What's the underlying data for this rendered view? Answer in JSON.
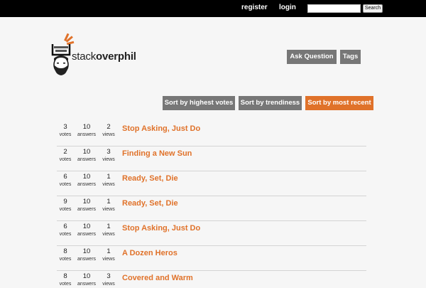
{
  "topbar": {
    "register": "register",
    "login": "login",
    "search_value": "",
    "search_button": "Search"
  },
  "logo": {
    "text_light": "stack",
    "text_bold": "overphil"
  },
  "header_buttons": {
    "ask": "Ask Question",
    "tags": "Tags"
  },
  "sort": {
    "highest_votes": "Sort by highest votes",
    "trendiness": "Sort by trendiness",
    "most_recent": "Sort by most recent",
    "active": "most_recent"
  },
  "colors": {
    "accent": "#e0722a",
    "button_gray": "#777777",
    "topbar": "#000000"
  },
  "questions": [
    {
      "votes": "3",
      "votes_label": "votes",
      "answers": "10",
      "answers_label": "answers",
      "views": "2",
      "views_label": "views",
      "title": "Stop Asking, Just Do"
    },
    {
      "votes": "2",
      "votes_label": "votes",
      "answers": "10",
      "answers_label": "answers",
      "views": "3",
      "views_label": "views",
      "title": "Finding a New Sun"
    },
    {
      "votes": "6",
      "votes_label": "votes",
      "answers": "10",
      "answers_label": "answers",
      "views": "1",
      "views_label": "views",
      "title": "Ready, Set, Die"
    },
    {
      "votes": "9",
      "votes_label": "votes",
      "answers": "10",
      "answers_label": "answers",
      "views": "1",
      "views_label": "views",
      "title": "Ready, Set, Die"
    },
    {
      "votes": "6",
      "votes_label": "votes",
      "answers": "10",
      "answers_label": "answers",
      "views": "1",
      "views_label": "views",
      "title": "Stop Asking, Just Do"
    },
    {
      "votes": "8",
      "votes_label": "votes",
      "answers": "10",
      "answers_label": "answers",
      "views": "1",
      "views_label": "views",
      "title": "A Dozen Heros"
    },
    {
      "votes": "8",
      "votes_label": "votes",
      "answers": "10",
      "answers_label": "answers",
      "views": "3",
      "views_label": "views",
      "title": "Covered and Warm"
    }
  ]
}
